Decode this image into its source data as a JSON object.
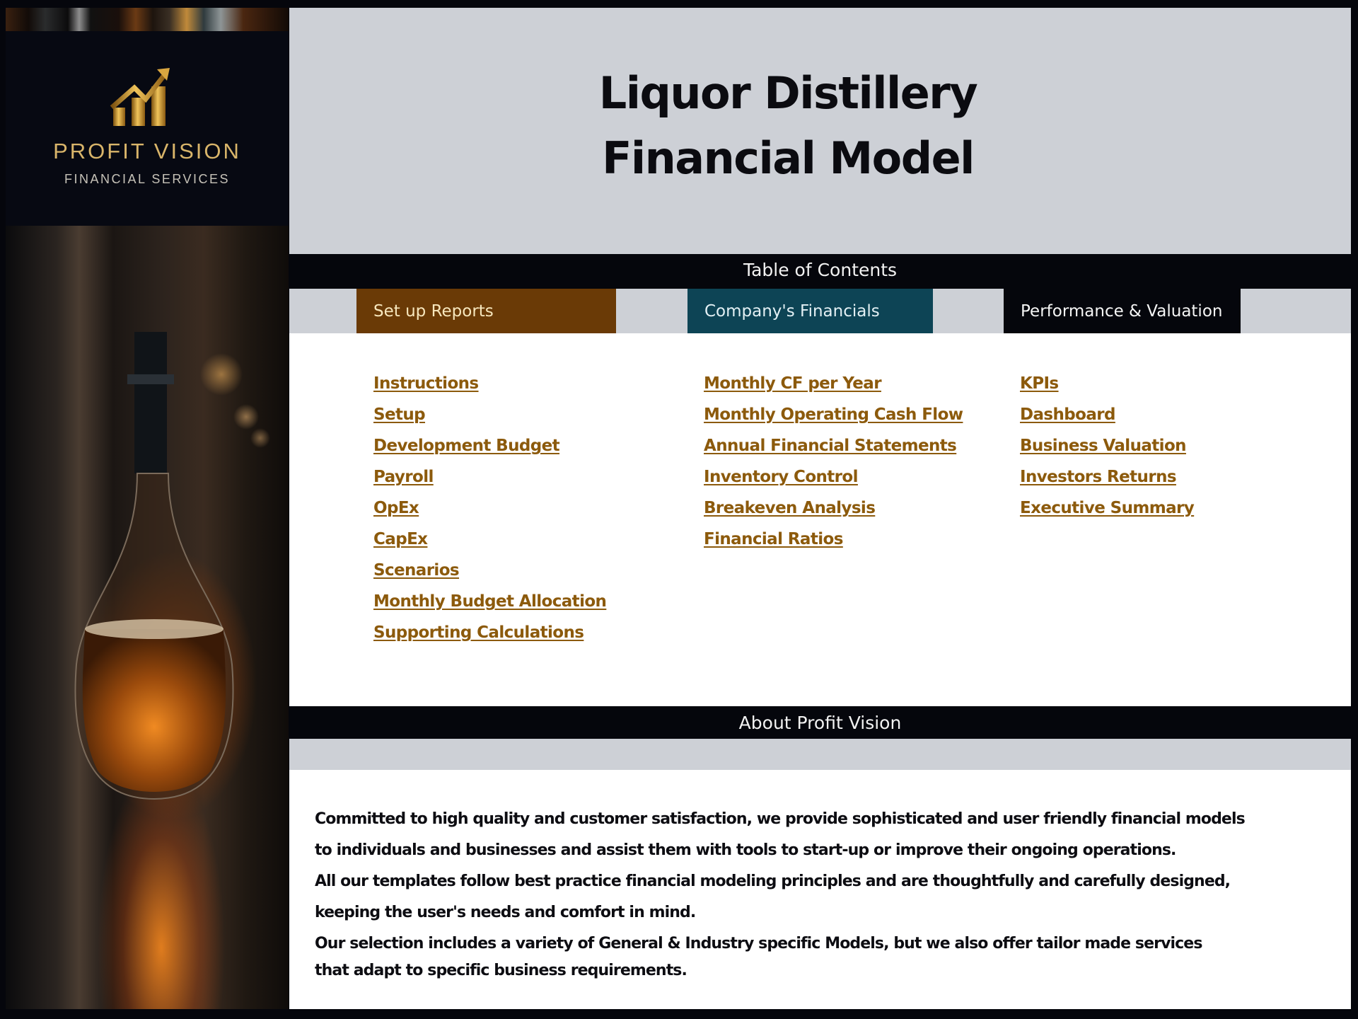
{
  "brand": {
    "name": "PROFIT VISION",
    "subtitle": "FINANCIAL SERVICES",
    "logo_icon": "rising-bar-chart-arrow-icon",
    "gold": "#d9b56a"
  },
  "title": {
    "line1": "Liquor Distillery",
    "line2": "Financial Model"
  },
  "toc": {
    "heading": "Table of Contents",
    "sections": [
      {
        "label": "Set up Reports",
        "color": "#6a3a06",
        "links": [
          "Instructions",
          "Setup",
          "Development Budget",
          "Payroll",
          "OpEx",
          "CapEx",
          "Scenarios",
          "Monthly Budget Allocation",
          "Supporting Calculations"
        ]
      },
      {
        "label": "Company's Financials",
        "color": "#0d4455",
        "links": [
          "Monthly CF per Year",
          "Monthly Operating Cash Flow",
          "Annual Financial Statements",
          "Inventory Control",
          "Breakeven Analysis",
          "Financial Ratios"
        ]
      },
      {
        "label": "Performance & Valuation",
        "color": "#05060c",
        "links": [
          "KPIs",
          "Dashboard",
          "Business Valuation",
          "Investors Returns",
          "Executive Summary"
        ]
      }
    ],
    "link_color": "#8c5a0c"
  },
  "about": {
    "heading": "About Profit Vision",
    "lines": [
      "Committed to high quality and customer satisfaction, we provide sophisticated and user friendly financial models",
      "to individuals and businesses and assist them  with tools to start-up or improve their ongoing operations.",
      "All our templates follow best practice financial modeling principles and are thoughtfully and carefully designed,",
      "keeping the user's needs and comfort in mind.",
      "Our selection includes a variety of General & Industry specific Models, but we also offer tailor made services",
      "that adapt to specific business requirements."
    ]
  }
}
